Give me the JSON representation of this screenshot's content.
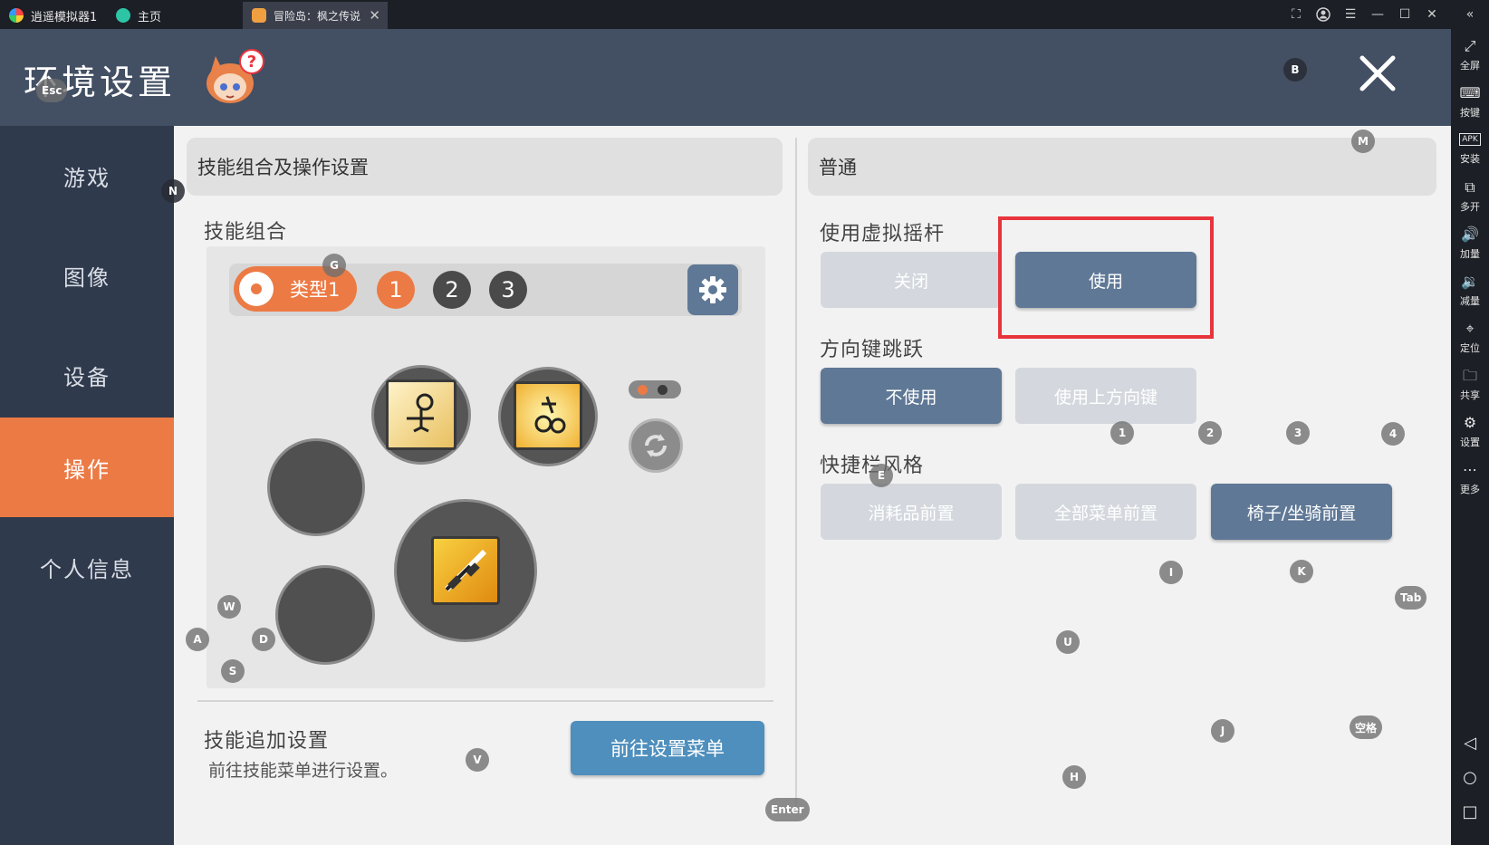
{
  "emulator": {
    "tabs": [
      {
        "label": "逍遥模拟器1"
      },
      {
        "label": "主页"
      },
      {
        "label": "冒险岛：枫之传说"
      }
    ],
    "toolbar": [
      {
        "label": "全屏",
        "icon": "fullscreen-icon",
        "glyph": "⤢"
      },
      {
        "label": "按键",
        "icon": "keyboard-icon",
        "glyph": "⌨"
      },
      {
        "label": "安装",
        "icon": "apk-icon",
        "glyph": "APK"
      },
      {
        "label": "多开",
        "icon": "multi-instance-icon",
        "glyph": "⧉"
      },
      {
        "label": "加量",
        "icon": "volume-up-icon",
        "glyph": "🔊"
      },
      {
        "label": "减量",
        "icon": "volume-down-icon",
        "glyph": "🔉"
      },
      {
        "label": "定位",
        "icon": "location-icon",
        "glyph": "⌖"
      },
      {
        "label": "共享",
        "icon": "folder-icon",
        "glyph": "🗀"
      },
      {
        "label": "设置",
        "icon": "gear-icon",
        "glyph": "⚙"
      },
      {
        "label": "更多",
        "icon": "more-icon",
        "glyph": "⋯"
      }
    ]
  },
  "header": {
    "title": "环境设置"
  },
  "sidebar": {
    "items": [
      {
        "label": "游戏"
      },
      {
        "label": "图像"
      },
      {
        "label": "设备"
      },
      {
        "label": "操作"
      },
      {
        "label": "个人信息"
      }
    ],
    "active_index": 3
  },
  "left_panel": {
    "title": "技能组合及操作设置",
    "skill_combo_label": "技能组合",
    "type_label": "类型1",
    "presets": [
      "1",
      "2",
      "3"
    ],
    "extra_title": "技能追加设置",
    "extra_desc": "前往技能菜单进行设置。",
    "goto_button": "前往设置菜单"
  },
  "right_panel": {
    "title": "普通",
    "virtual_joystick": {
      "label": "使用虚拟摇杆",
      "options": [
        "关闭",
        "使用"
      ],
      "selected": "使用"
    },
    "direction_jump": {
      "label": "方向键跳跃",
      "options": [
        "不使用",
        "使用上方向键"
      ],
      "selected": "不使用"
    },
    "quickbar_style": {
      "label": "快捷栏风格",
      "options": [
        "消耗品前置",
        "全部菜单前置",
        "椅子/坐骑前置"
      ],
      "selected": "椅子/坐骑前置"
    }
  },
  "key_hints": {
    "esc": "Esc",
    "b": "B",
    "m": "M",
    "n": "N",
    "g": "G",
    "w": "W",
    "a": "A",
    "s": "S",
    "d": "D",
    "v": "V",
    "enter": "Enter",
    "k1": "1",
    "k2": "2",
    "k3": "3",
    "k4": "4",
    "e": "E",
    "i": "I",
    "k": "K",
    "tab": "Tab",
    "u": "U",
    "j": "J",
    "h": "H",
    "space": "空格"
  },
  "colors": {
    "accent": "#ec7a44",
    "header": "#434f63",
    "sidebar": "#2f3a4c",
    "button_on": "#5f7896",
    "button_off": "#d4d8de",
    "primary": "#4f8fbd",
    "highlight": "#e8343c"
  }
}
